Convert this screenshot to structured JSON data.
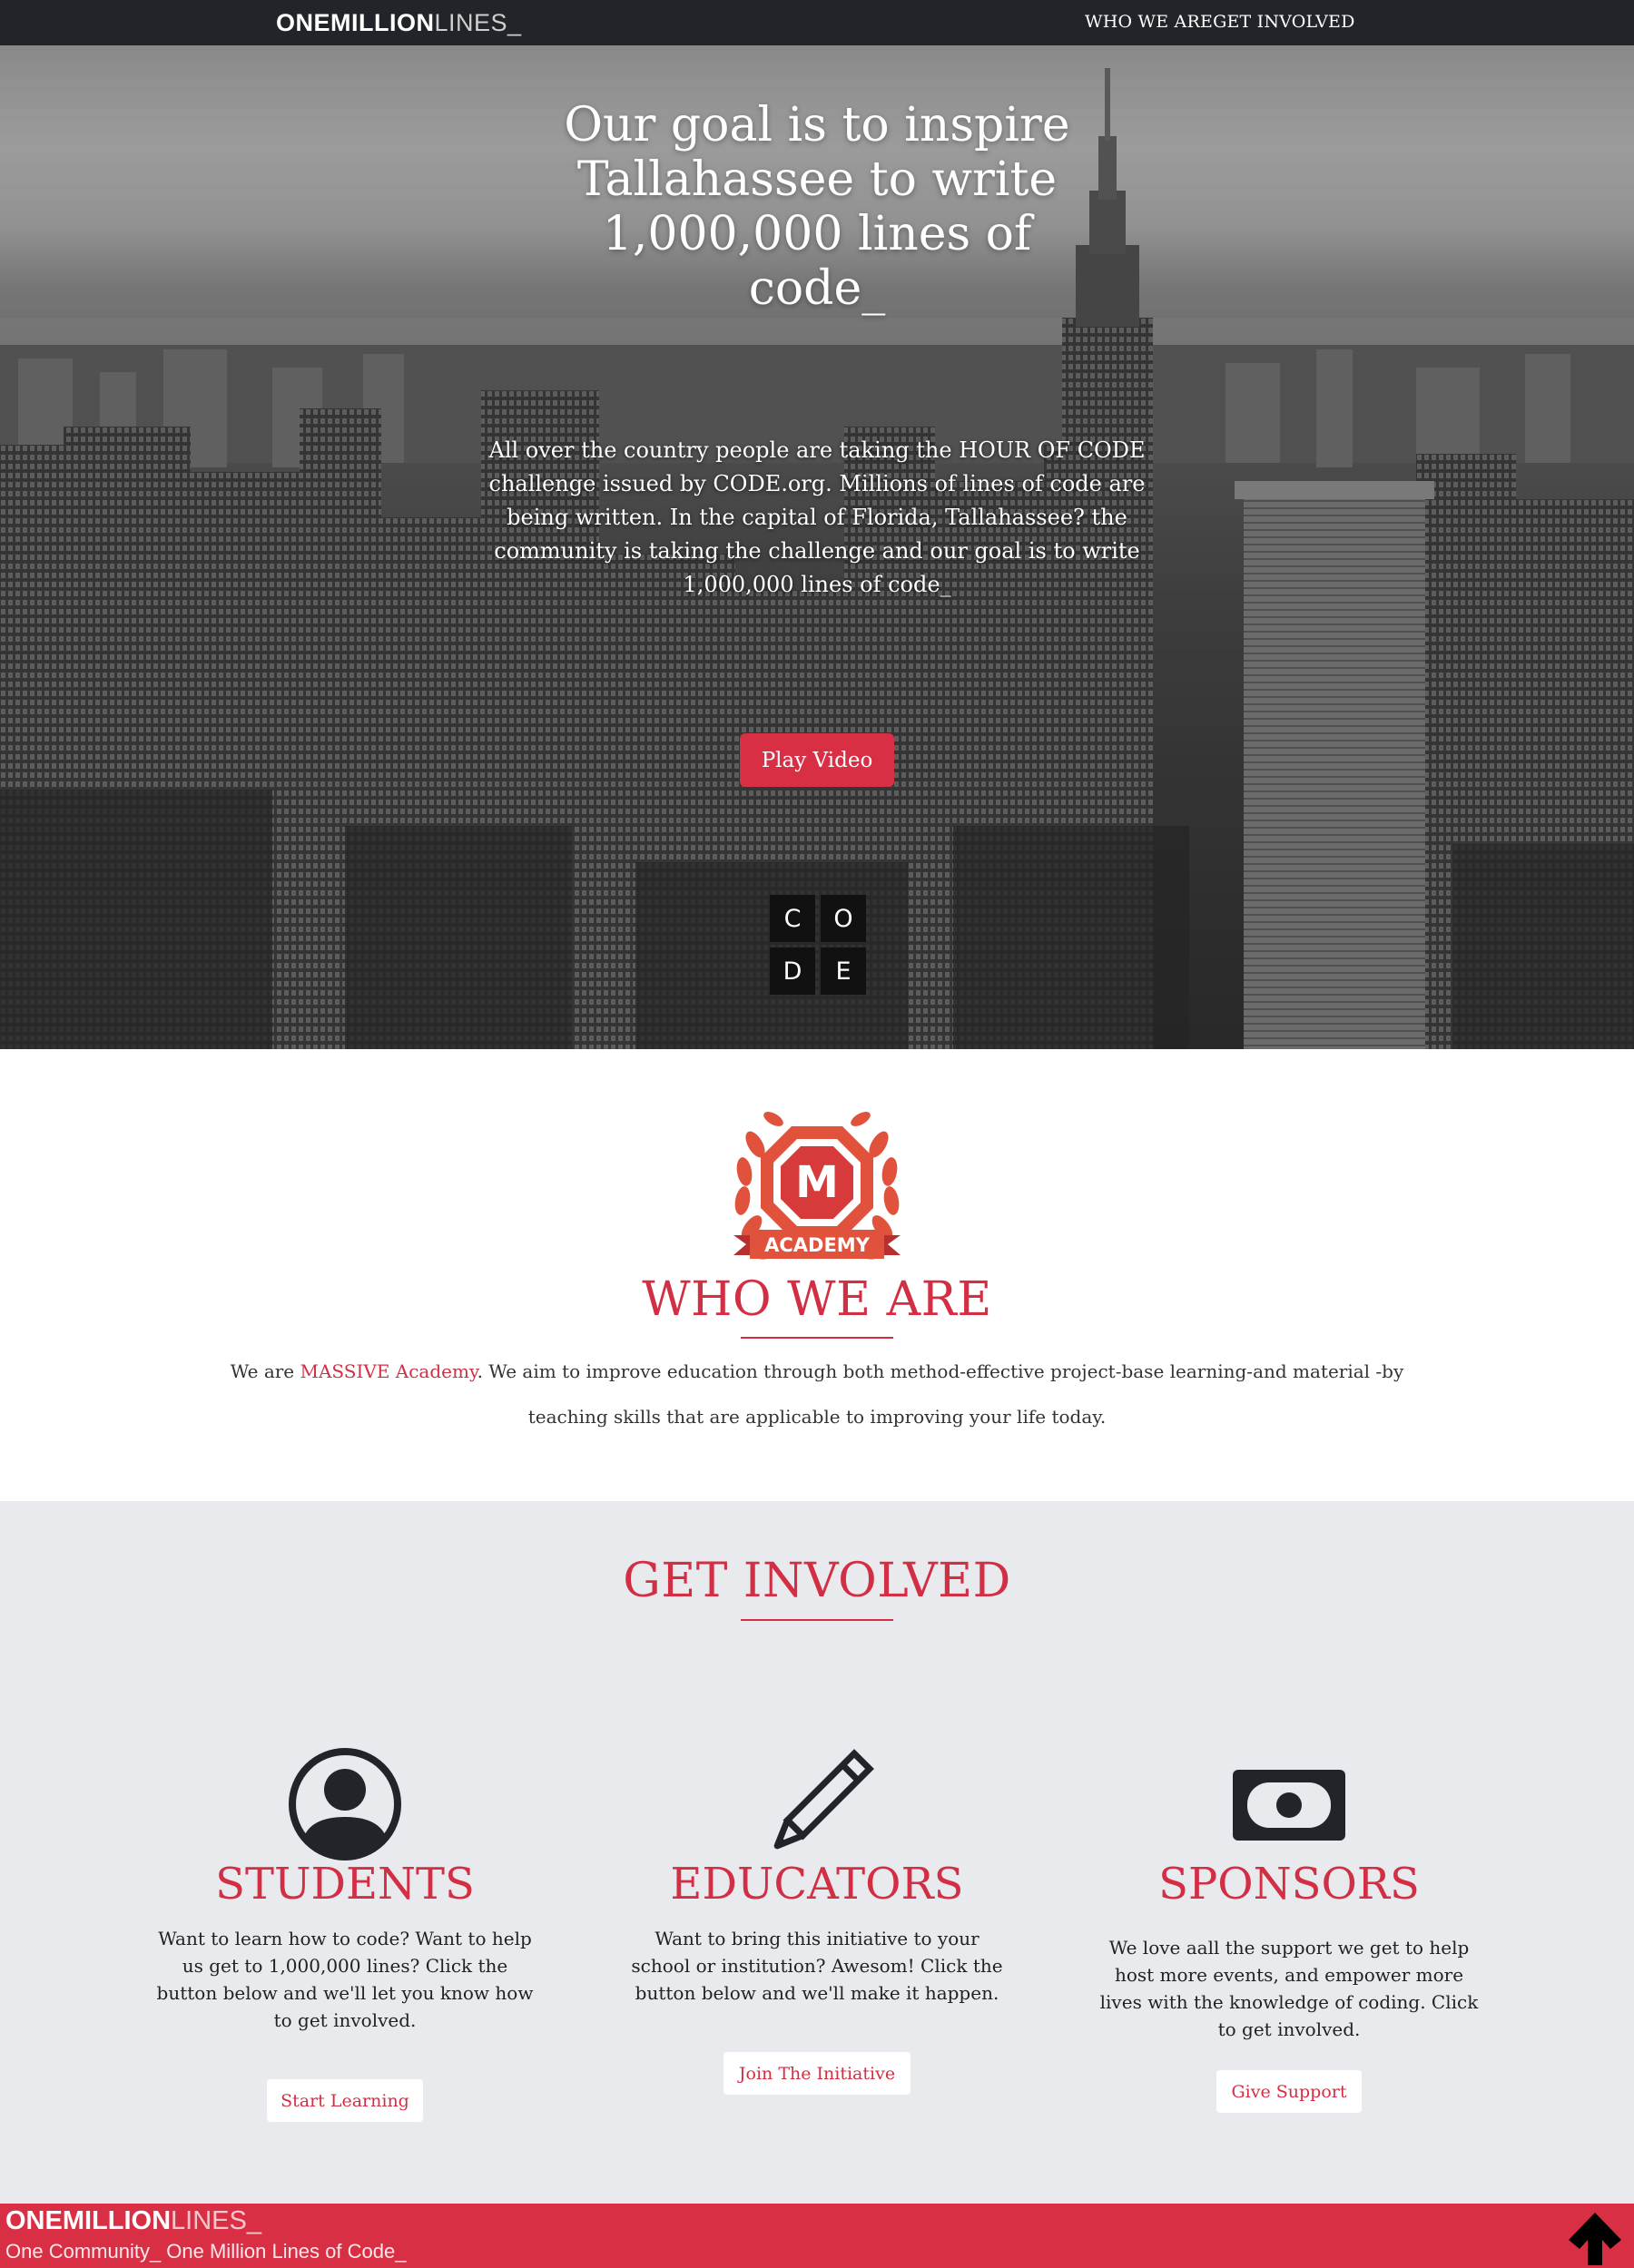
{
  "nav": {
    "logo_bold": "ONEMILLION",
    "logo_light": "LINES_",
    "link_who": "WHO WE ARE",
    "link_involved": "GET INVOLVED"
  },
  "hero": {
    "title": "Our goal is to inspire Tallahassee to write 1,000,000 lines of code_",
    "text": "All over the country people are taking the HOUR OF CODE challenge issued by CODE.org. Millions of lines of code are being written. In the capital of Florida, Tallahassee? the community is taking the challenge and our goal is to write 1,000,000 lines of code_",
    "play_button": "Play Video",
    "code_letters": [
      "C",
      "O",
      "D",
      "E"
    ]
  },
  "who": {
    "badge_letter": "M",
    "badge_label": "ACADEMY",
    "title": "WHO WE ARE",
    "text_before": "We are ",
    "text_link": "MASSIVE Academy",
    "text_after": ". We aim to improve education through both method-effective project-base learning-and material -by teaching skills that are applicable to improving your life today."
  },
  "involved": {
    "title": "GET INVOLVED",
    "columns": [
      {
        "icon": "user-circle-icon",
        "title": "STUDENTS",
        "text": "Want to learn how to code? Want to help us get to 1,000,000 lines? Click the button below and we'll let you know how to get involved.",
        "button": "Start Learning"
      },
      {
        "icon": "pencil-icon",
        "title": "EDUCATORS",
        "text": "Want to bring this initiative to your school or institution? Awesom! Click the button below and we'll make it happen.",
        "button": "Join The Initiative"
      },
      {
        "icon": "money-bill-icon",
        "title": "SPONSORS",
        "text": "We love aall the support we get to help host more events, and empower more lives with the knowledge of coding. Click to get involved.",
        "button": "Give Support"
      }
    ]
  },
  "footer": {
    "logo_bold": "ONEMILLION",
    "logo_light": "LINES_",
    "tagline": "One Community_ One Million Lines of Code_",
    "top_icon": "arrow-up-icon"
  },
  "colors": {
    "accent": "#d22e44",
    "nav_bg": "#212529",
    "section_bg": "#e8eaed",
    "footer_bg": "#d92f44"
  }
}
